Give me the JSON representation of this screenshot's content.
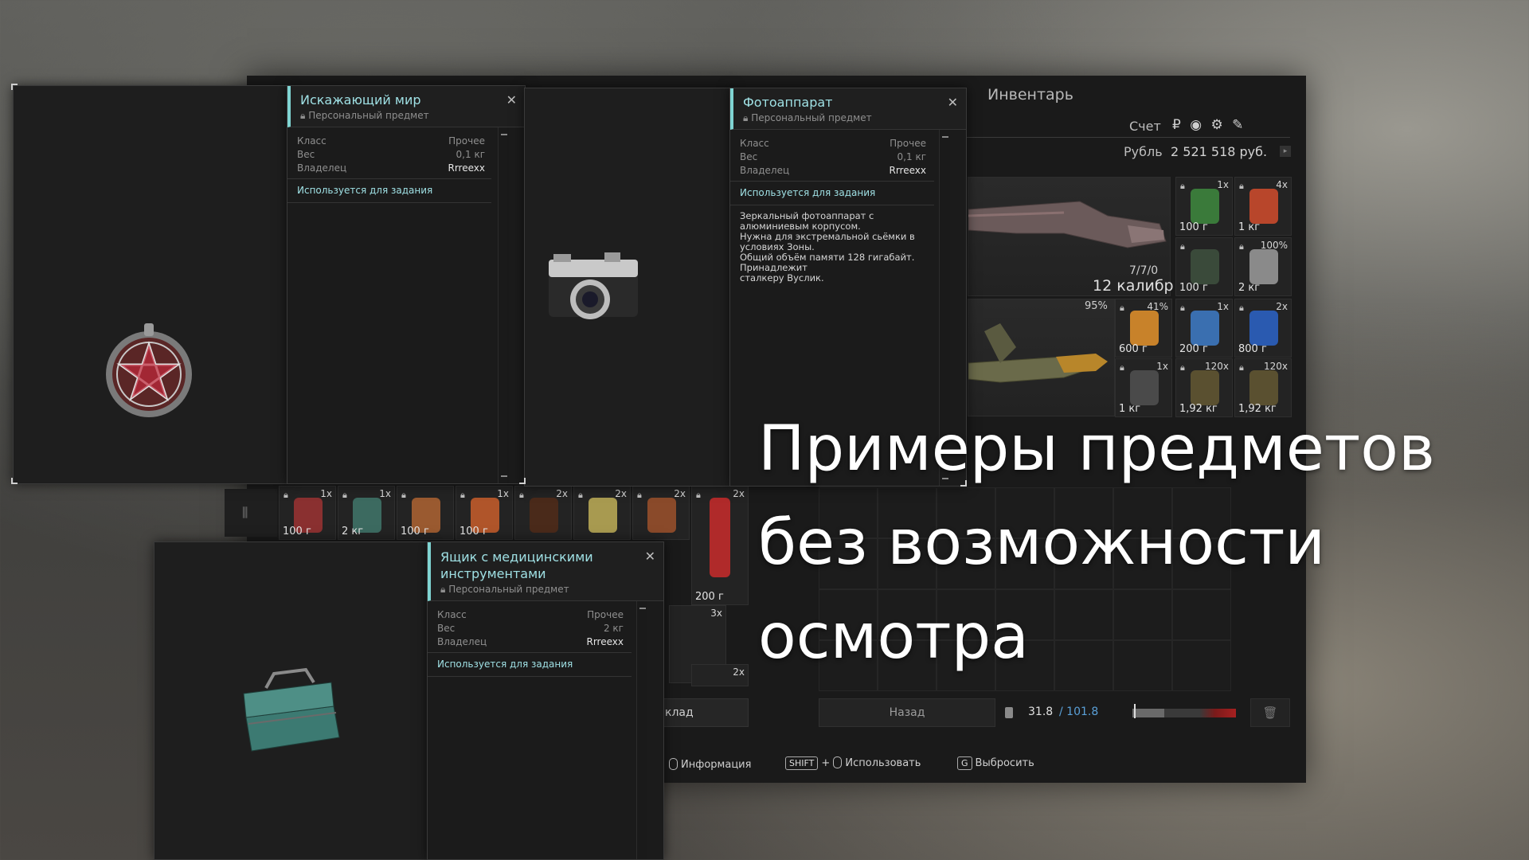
{
  "inventory": {
    "title": "Инвентарь",
    "account_label": "Счет",
    "account_icons": "₽ ◉ ⚙ ✎",
    "currency_label": "Рубль",
    "balance": "2 521 518 руб.",
    "weapon_primary": {
      "ammo": "7/7/0",
      "caliber": "12 калибр"
    },
    "weapon_secondary": {
      "durability": "95%"
    },
    "items": [
      {
        "count": "1x",
        "weight": "100 г",
        "color": "#3a7a3a"
      },
      {
        "count": "4x",
        "weight": "1 кг",
        "color": "#b8462b"
      },
      {
        "count": "",
        "weight": "100 г",
        "color": "#3a4a3a"
      },
      {
        "count": "100%",
        "weight": "2 кг",
        "color": "#8a8a8a"
      },
      {
        "count": "41%",
        "weight": "600 г",
        "color": "#c8822a"
      },
      {
        "count": "1x",
        "weight": "200 г",
        "color": "#3a6fb0"
      },
      {
        "count": "2x",
        "weight": "800 г",
        "color": "#2a5ab0"
      },
      {
        "count": "1x",
        "weight": "1 кг",
        "color": "#4a4a4a"
      },
      {
        "count": "120x",
        "weight": "1,92 кг",
        "color": "#5a5030"
      },
      {
        "count": "120x",
        "weight": "1,92 кг",
        "color": "#5a5030"
      }
    ],
    "stash_items": [
      {
        "count": "1x",
        "weight": "100 г",
        "color": "#8a3030"
      },
      {
        "count": "1x",
        "weight": "2 кг",
        "color": "#3c6a60"
      },
      {
        "count": "",
        "weight": "100 г",
        "color": "#9a5a30"
      },
      {
        "count": "1x",
        "weight": "100 г",
        "color": "#b0552a"
      },
      {
        "count": "2x",
        "weight": "",
        "color": "#4a2a1a"
      },
      {
        "count": "2x",
        "weight": "",
        "color": "#a89a50"
      },
      {
        "count": "2x",
        "weight": "",
        "color": "#8a4a2a"
      },
      {
        "count": "2x",
        "weight": "200 г",
        "color": "#b02a2a"
      }
    ],
    "stash_extra": [
      "3x",
      "2x"
    ],
    "storage_label": "клад",
    "back_label": "Назад",
    "weight_current": "31.8",
    "weight_max": "/ 101.8",
    "weight_fraction": 0.31,
    "hints": {
      "info": "Информация",
      "shift_key": "SHIFT",
      "use": "Использовать",
      "drop_key": "G",
      "drop": "Выбросить"
    }
  },
  "popups": [
    {
      "title": "Искажающий мир",
      "subtitle": "Персональный предмет",
      "class_label": "Класс",
      "class_value": "Прочее",
      "weight_label": "Вес",
      "weight_value": "0,1 кг",
      "owner_label": "Владелец",
      "owner_value": "Rrreexx",
      "quest_label": "Используется для задания",
      "description": "",
      "preview_icon": "pentagram-pendant-icon"
    },
    {
      "title": "Фотоаппарат",
      "subtitle": "Персональный предмет",
      "class_label": "Класс",
      "class_value": "Прочее",
      "weight_label": "Вес",
      "weight_value": "0,1 кг",
      "owner_label": "Владелец",
      "owner_value": "Rrreexx",
      "quest_label": "Используется для задания",
      "description": "Зеркальный фотоаппарат с\nалюминиевым корпусом.\nНужна для экстремальной сьёмки в\nусловиях Зоны.\nОбщий объём памяти 128 гигабайт.\nПринадлежит\nсталкеру Вуслик.",
      "preview_icon": "camera-icon"
    },
    {
      "title": "Ящик с медицинскими инструментами",
      "subtitle": "Персональный предмет",
      "class_label": "Класс",
      "class_value": "Прочее",
      "weight_label": "Вес",
      "weight_value": "2 кг",
      "owner_label": "Владелец",
      "owner_value": "Rrreexx",
      "quest_label": "Используется для задания",
      "description": "",
      "preview_icon": "toolbox-icon"
    }
  ],
  "overlay_caption": "Примеры предметов\nбез возможности\nосмотра"
}
